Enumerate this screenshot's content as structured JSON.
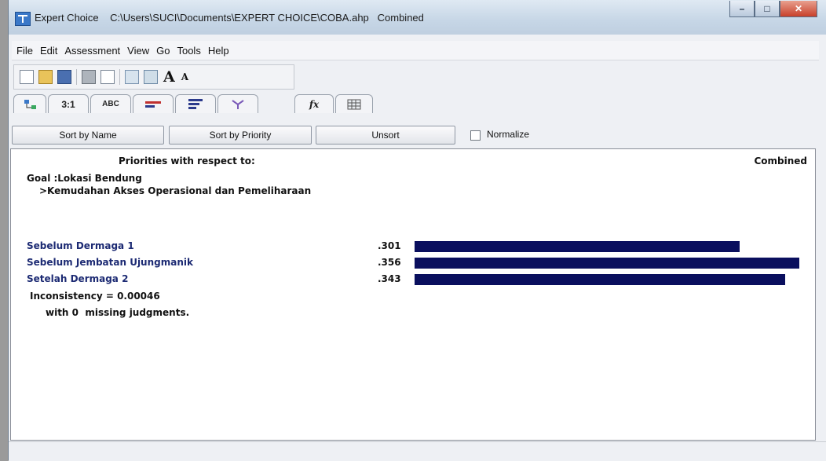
{
  "window": {
    "app_name": "Expert Choice",
    "file_path": "C:\\Users\\SUCI\\Documents\\EXPERT CHOICE\\COBA.ahp",
    "mode": "Combined"
  },
  "menu": [
    "File",
    "Edit",
    "Assessment",
    "View",
    "Go",
    "Tools",
    "Help"
  ],
  "toolbar": {
    "icons": [
      "new-icon",
      "open-icon",
      "save-icon",
      "print-icon",
      "print-preview-icon",
      "tree-icon",
      "tree-plus-icon",
      "font-larger-icon",
      "font-smaller-icon"
    ],
    "font_big_label": "A",
    "font_small_label": "A"
  },
  "tabs": [
    {
      "id": "tree",
      "label": ""
    },
    {
      "id": "pairwise-numeric",
      "label": "3:1"
    },
    {
      "id": "pairwise-verbal",
      "label": "ABC"
    },
    {
      "id": "graphical",
      "label": ""
    },
    {
      "id": "priorities",
      "label": ""
    },
    {
      "id": "ratings",
      "label": ""
    },
    {
      "id": "formula",
      "label": "fx"
    },
    {
      "id": "grid",
      "label": ""
    }
  ],
  "sort_buttons": {
    "by_name": "Sort by Name",
    "by_priority": "Sort by Priority",
    "unsort": "Unsort",
    "normalize": "Normalize"
  },
  "report": {
    "heading": "Priorities with respect to:",
    "combined": "Combined",
    "goal": "Goal :Lokasi Bendung",
    "criterion": ">Kemudahan Akses Operasional dan Pemeliharaan",
    "items": [
      {
        "name": "Sebelum Dermaga 1",
        "priority": ".301",
        "value": 0.301
      },
      {
        "name": "Sebelum Jembatan Ujungmanik",
        "priority": ".356",
        "value": 0.356
      },
      {
        "name": "Setelah Dermaga 2",
        "priority": ".343",
        "value": 0.343
      }
    ],
    "inconsistency": "Inconsistency = 0.00046",
    "missing": "with 0  missing judgments.",
    "bar_color": "#0a0f5e"
  }
}
